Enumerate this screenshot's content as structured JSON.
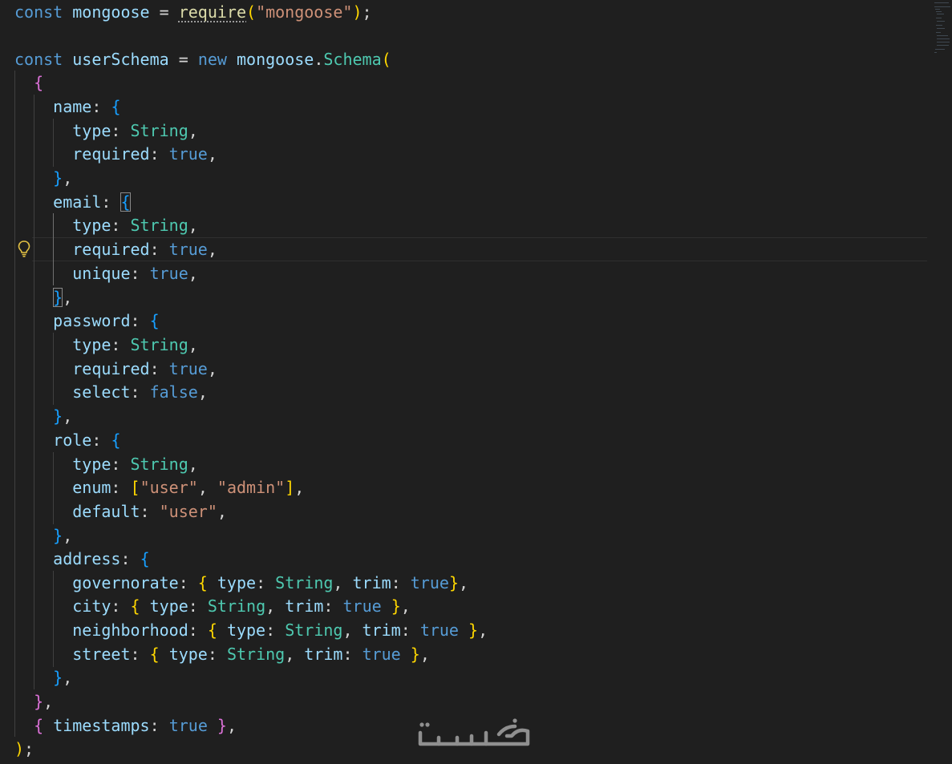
{
  "code": {
    "l1": {
      "kw": "const",
      "name": "mongoose",
      "eq": " = ",
      "fn": "require",
      "op": "(",
      "str": "\"mongoose\"",
      "cl": ")",
      "semi": ";"
    },
    "l3": {
      "kw": "const",
      "name": "userSchema",
      "eq": " = ",
      "new": "new",
      "obj": "mongoose",
      "dot": ".",
      "cls": "Schema",
      "op": "("
    },
    "l4": {
      "br": "{"
    },
    "l5": {
      "key": "name",
      "colon": ": ",
      "br": "{"
    },
    "l6": {
      "key": "type",
      "colon": ": ",
      "val": "String",
      "comma": ","
    },
    "l7": {
      "key": "required",
      "colon": ": ",
      "val": "true",
      "comma": ","
    },
    "l8": {
      "br": "}",
      "comma": ","
    },
    "l9": {
      "key": "email",
      "colon": ": ",
      "br": "{"
    },
    "l10": {
      "key": "type",
      "colon": ": ",
      "val": "String",
      "comma": ","
    },
    "l11": {
      "key": "required",
      "colon": ": ",
      "val": "true",
      "comma": ","
    },
    "l12": {
      "key": "unique",
      "colon": ": ",
      "val": "true",
      "comma": ","
    },
    "l13": {
      "br": "}",
      "comma": ","
    },
    "l14": {
      "key": "password",
      "colon": ": ",
      "br": "{"
    },
    "l15": {
      "key": "type",
      "colon": ": ",
      "val": "String",
      "comma": ","
    },
    "l16": {
      "key": "required",
      "colon": ": ",
      "val": "true",
      "comma": ","
    },
    "l17": {
      "key": "select",
      "colon": ": ",
      "val": "false",
      "comma": ","
    },
    "l18": {
      "br": "}",
      "comma": ","
    },
    "l19": {
      "key": "role",
      "colon": ": ",
      "br": "{"
    },
    "l20": {
      "key": "type",
      "colon": ": ",
      "val": "String",
      "comma": ","
    },
    "l21": {
      "key": "enum",
      "colon": ": ",
      "ob": "[",
      "s1": "\"user\"",
      "sep": ", ",
      "s2": "\"admin\"",
      "cb": "]",
      "comma": ","
    },
    "l22": {
      "key": "default",
      "colon": ": ",
      "str": "\"user\"",
      "comma": ","
    },
    "l23": {
      "br": "}",
      "comma": ","
    },
    "l24": {
      "key": "address",
      "colon": ": ",
      "br": "{"
    },
    "l25": {
      "key": "governorate",
      "colon": ": ",
      "ob": "{ ",
      "k1": "type",
      "c1": ": ",
      "v1": "String",
      "sep": ", ",
      "k2": "trim",
      "c2": ": ",
      "v2": "true",
      "cb": "}",
      "comma": ","
    },
    "l26": {
      "key": "city",
      "colon": ": ",
      "ob": "{ ",
      "k1": "type",
      "c1": ": ",
      "v1": "String",
      "sep": ", ",
      "k2": "trim",
      "c2": ": ",
      "v2": "true",
      "cb": " }",
      "comma": ","
    },
    "l27": {
      "key": "neighborhood",
      "colon": ": ",
      "ob": "{ ",
      "k1": "type",
      "c1": ": ",
      "v1": "String",
      "sep": ", ",
      "k2": "trim",
      "c2": ": ",
      "v2": "true",
      "cb": " }",
      "comma": ","
    },
    "l28": {
      "key": "street",
      "colon": ": ",
      "ob": "{ ",
      "k1": "type",
      "c1": ": ",
      "v1": "String",
      "sep": ", ",
      "k2": "trim",
      "c2": ": ",
      "v2": "true",
      "cb": " }",
      "comma": ","
    },
    "l29": {
      "br": "}",
      "comma": ","
    },
    "l30": {
      "br": "}",
      "comma": ","
    },
    "l31": {
      "ob": "{ ",
      "key": "timestamps",
      "colon": ": ",
      "val": "true",
      "cb": " }",
      "comma": ","
    },
    "l32": {
      "br": ")",
      "semi": ";"
    }
  },
  "watermark": {
    "text": "خمسات"
  },
  "icons": {
    "lightbulb": "lightbulb-icon"
  },
  "colors": {
    "background": "#1f1f1f",
    "keyword": "#569cd6",
    "variable": "#9cdcfe",
    "type": "#4ec9b0",
    "string": "#ce9178",
    "bracket1": "#ffd700",
    "bracket2": "#da70d6",
    "bracket3": "#179fff"
  }
}
